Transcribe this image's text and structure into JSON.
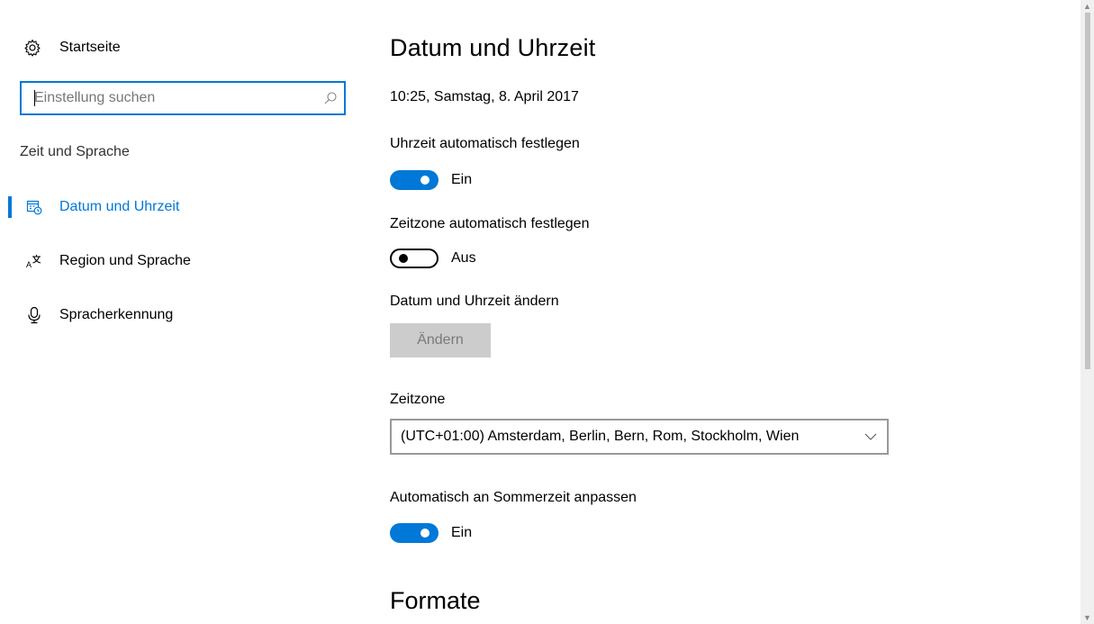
{
  "sidebar": {
    "home_label": "Startseite",
    "search_placeholder": "Einstellung suchen",
    "section_title": "Zeit und Sprache",
    "items": [
      {
        "label": "Datum und Uhrzeit",
        "icon": "calendar-clock-icon",
        "active": true
      },
      {
        "label": "Region und Sprache",
        "icon": "language-icon",
        "active": false
      },
      {
        "label": "Spracherkennung",
        "icon": "microphone-icon",
        "active": false
      }
    ]
  },
  "main": {
    "title": "Datum und Uhrzeit",
    "current_datetime": "10:25, Samstag, 8. April 2017",
    "auto_time": {
      "label": "Uhrzeit automatisch festlegen",
      "state": "Ein",
      "on": true
    },
    "auto_timezone": {
      "label": "Zeitzone automatisch festlegen",
      "state": "Aus",
      "on": false
    },
    "change_datetime": {
      "label": "Datum und Uhrzeit ändern",
      "button": "Ändern"
    },
    "timezone": {
      "label": "Zeitzone",
      "value": "(UTC+01:00) Amsterdam, Berlin, Bern, Rom, Stockholm, Wien"
    },
    "dst": {
      "label": "Automatisch an Sommerzeit anpassen",
      "state": "Ein",
      "on": true
    },
    "formats_heading": "Formate"
  },
  "colors": {
    "accent": "#0078d7",
    "disabled_button": "#cccccc"
  }
}
